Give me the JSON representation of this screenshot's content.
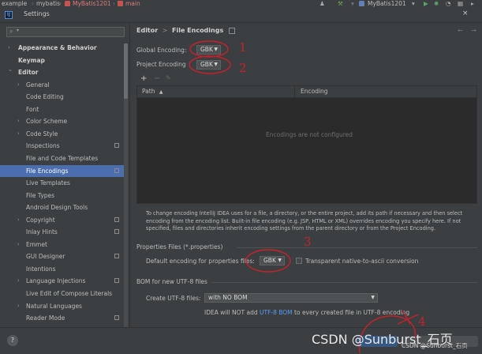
{
  "topbar": {
    "crumbs": [
      "example",
      "mybatis",
      "MyBatis1201",
      "main"
    ],
    "run_config": "MyBatis1201"
  },
  "window": {
    "title": "Settings",
    "icon": "intellij-icon",
    "close": "×"
  },
  "search": {
    "placeholder": "",
    "icon": "search-icon"
  },
  "sidebar": {
    "items": [
      {
        "label": "Appearance & Behavior",
        "bold": true,
        "arrow": ">",
        "level": 0
      },
      {
        "label": "Keymap",
        "bold": true,
        "arrow": "",
        "level": 0
      },
      {
        "label": "Editor",
        "bold": true,
        "arrow": "v",
        "level": 0
      },
      {
        "label": "General",
        "arrow": ">",
        "level": 1
      },
      {
        "label": "Code Editing",
        "arrow": "",
        "level": 1
      },
      {
        "label": "Font",
        "arrow": "",
        "level": 1
      },
      {
        "label": "Color Scheme",
        "arrow": ">",
        "level": 1
      },
      {
        "label": "Code Style",
        "arrow": ">",
        "level": 1
      },
      {
        "label": "Inspections",
        "arrow": "",
        "level": 1,
        "badge": true
      },
      {
        "label": "File and Code Templates",
        "arrow": "",
        "level": 1
      },
      {
        "label": "File Encodings",
        "arrow": "",
        "level": 1,
        "badge": true,
        "selected": true
      },
      {
        "label": "Live Templates",
        "arrow": "",
        "level": 1
      },
      {
        "label": "File Types",
        "arrow": "",
        "level": 1
      },
      {
        "label": "Android Design Tools",
        "arrow": "",
        "level": 1
      },
      {
        "label": "Copyright",
        "arrow": ">",
        "level": 1,
        "badge": true
      },
      {
        "label": "Inlay Hints",
        "arrow": "",
        "level": 1,
        "badge": true
      },
      {
        "label": "Emmet",
        "arrow": ">",
        "level": 1
      },
      {
        "label": "GUI Designer",
        "arrow": "",
        "level": 1,
        "badge": true
      },
      {
        "label": "Intentions",
        "arrow": "",
        "level": 1
      },
      {
        "label": "Language Injections",
        "arrow": ">",
        "level": 1,
        "badge": true
      },
      {
        "label": "Live Edit of Compose Literals",
        "arrow": "",
        "level": 1
      },
      {
        "label": "Natural Languages",
        "arrow": ">",
        "level": 1
      },
      {
        "label": "Reader Mode",
        "arrow": "",
        "level": 1,
        "badge": true
      }
    ]
  },
  "breadcrumb": {
    "parent": "Editor",
    "separator": ">",
    "current": "File Encodings"
  },
  "encodings": {
    "global_label": "Global Encoding:",
    "global_value": "GBK",
    "project_label": "Project Encoding",
    "project_value": "GBK"
  },
  "table": {
    "add": "+",
    "remove": "−",
    "edit": "✎",
    "col_path": "Path",
    "col_encoding": "Encoding",
    "empty_text": "Encodings are not configured"
  },
  "description": "To change encoding IntelliJ IDEA uses for a file, a directory, or the entire project, add its path if necessary and then select encoding from the encoding list. Built-in file encoding (e.g. JSP, HTML or XML) overrides encoding you specify here. If not specified, files and directories inherit encoding settings from the parent directory or from the Project Encoding.",
  "properties": {
    "section_title": "Properties Files (*.properties)",
    "default_label": "Default encoding for properties files:",
    "default_value": "GBK",
    "transparent_label": "Transparent native-to-ascii conversion",
    "transparent_checked": false
  },
  "bom": {
    "section_title": "BOM for new UTF-8 files",
    "create_label": "Create UTF-8 files:",
    "create_value": "with NO BOM",
    "note_prefix": "IDEA will NOT add ",
    "note_link": "UTF-8 BOM",
    "note_suffix": " to every created file in UTF-8 encoding"
  },
  "annotations": [
    "1",
    "2",
    "3",
    "4"
  ],
  "watermark": {
    "large": "CSDN @Sunburst_石页",
    "small": "CSDN @Sunburst_石页"
  },
  "help": "?",
  "colors": {
    "selection": "#4b6eaf",
    "link": "#589df6",
    "annotation": "#c8202a"
  }
}
